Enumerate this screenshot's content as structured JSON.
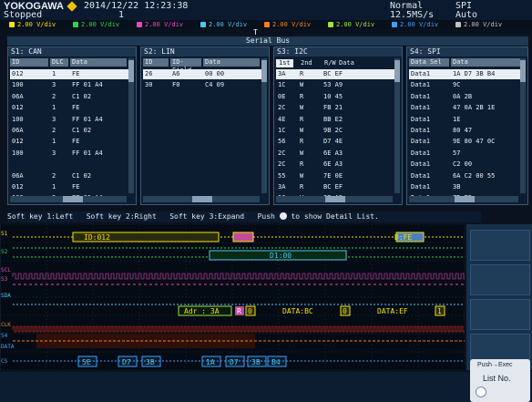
{
  "header": {
    "brand": "YOKOGAWA",
    "datetime": "2014/12/22 12:23:38",
    "state": "Stopped",
    "count": "1",
    "mode": "Normal",
    "sample_rate": "12.5MS/s",
    "trigger_type": "SPI",
    "trigger_mode": "Auto"
  },
  "channels": [
    {
      "label": "2.00 V/div",
      "color": "#f5e200"
    },
    {
      "label": "2.00 V/div",
      "color": "#2ad84a"
    },
    {
      "label": "2.00 V/div",
      "color": "#e84ac0"
    },
    {
      "label": "2.00 V/div",
      "color": "#4ac8f0"
    },
    {
      "label": "2.00 V/div",
      "color": "#f08020"
    },
    {
      "label": "2.00 V/div",
      "color": "#a0e040"
    },
    {
      "label": "2.00 V/div",
      "color": "#40a0ff"
    },
    {
      "label": "2.00 V/div",
      "color": "#c0c0c0"
    }
  ],
  "trigger_marker": "T",
  "serial_bus_title": "Serial Bus",
  "s1": {
    "title": "S1: CAN",
    "headers": [
      "ID",
      "DLC",
      "Data"
    ],
    "rows": [
      [
        "012",
        "1",
        "FE"
      ],
      [
        "100",
        "3",
        "FF 01 A4"
      ],
      [
        "06A",
        "2",
        "C1 02"
      ],
      [
        "012",
        "1",
        "FE"
      ],
      [
        "100",
        "3",
        "FF 01 A4"
      ],
      [
        "06A",
        "2",
        "C1 02"
      ],
      [
        "012",
        "1",
        "FE"
      ],
      [
        "100",
        "3",
        "FF 01 A4"
      ],
      [
        "",
        "",
        ""
      ],
      [
        "06A",
        "2",
        "C1 02"
      ],
      [
        "012",
        "1",
        "FE"
      ],
      [
        "100",
        "3",
        "FF 01 A4"
      ]
    ],
    "selected_row": 0
  },
  "s2": {
    "title": "S2: LIN",
    "headers": [
      "ID",
      "ID-Field",
      "Data"
    ],
    "rows": [
      [
        "26",
        "A6",
        "00 00"
      ],
      [
        "30",
        "F0",
        "C4 09"
      ]
    ],
    "selected_row": 0
  },
  "s3": {
    "title": "S3: I2C",
    "tabs": [
      "1st",
      "2nd",
      "R/W",
      "Data"
    ],
    "rows": [
      [
        "3A",
        "R",
        "BC EF"
      ],
      [
        "1C",
        "W",
        "53 A9"
      ],
      [
        "0E",
        "R",
        "10 45"
      ],
      [
        "2C",
        "W",
        "FB 21"
      ],
      [
        "4E",
        "R",
        "BB E2"
      ],
      [
        "1C",
        "W",
        "9B 2C"
      ],
      [
        "56",
        "R",
        "D7 4E"
      ],
      [
        "2C",
        "W",
        "6E A3"
      ],
      [
        "2C",
        "R",
        "6E A3"
      ],
      [
        "55",
        "W",
        "7E 0E"
      ],
      [
        "3A",
        "R",
        "BC EF"
      ],
      [
        "1C",
        "W",
        "53 A9"
      ]
    ],
    "selected_row": 0
  },
  "s4": {
    "title": "S4: SPI",
    "headers": [
      "Data Sel",
      "Data"
    ],
    "rows": [
      [
        "Data1",
        "1A D7 3B B4"
      ],
      [
        "Data1",
        "9C"
      ],
      [
        "Data1",
        "0A 2B"
      ],
      [
        "Data1",
        "47 0A 2B 1E"
      ],
      [
        "Data1",
        "1E"
      ],
      [
        "Data1",
        "80 47"
      ],
      [
        "Data1",
        "9E 80 47 0C"
      ],
      [
        "Data1",
        "57"
      ],
      [
        "Data1",
        "C2 00"
      ],
      [
        "Data1",
        "6A C2 00 55"
      ],
      [
        "Data1",
        "3B"
      ],
      [
        "Data1",
        "7D E5"
      ]
    ],
    "selected_row": 0
  },
  "softkeys": {
    "k1": "Soft key 1:Left",
    "k2": "Soft key 2:Right",
    "k3": "Soft key 3:Expand",
    "push_pre": "Push",
    "push_post": "to show Detail List."
  },
  "wave": {
    "can_id": "ID:012",
    "can_data": "D:FE",
    "lin_data": "D1:00",
    "i2c_addr": "Adr : 3A",
    "i2c_r": "R",
    "i2c_0a": "0",
    "i2c_d1": "DATA:BC",
    "i2c_0b": "0",
    "i2c_d2": "DATA:EF",
    "i2c_1": "1",
    "spi_b1": "5E",
    "spi_b2": "D7",
    "spi_b3": "3B",
    "spi_b4": "1A",
    "spi_b5": "D7",
    "spi_b6": "3B",
    "spi_b7": "B4",
    "labels_left": [
      "S1",
      "S2",
      "SCL",
      "S3",
      "SDA",
      "CLK",
      "S4",
      "DATA",
      "CS"
    ]
  },
  "listbtn": {
    "push": "Push",
    "push_suffix": "→Exec",
    "label": "List No."
  }
}
